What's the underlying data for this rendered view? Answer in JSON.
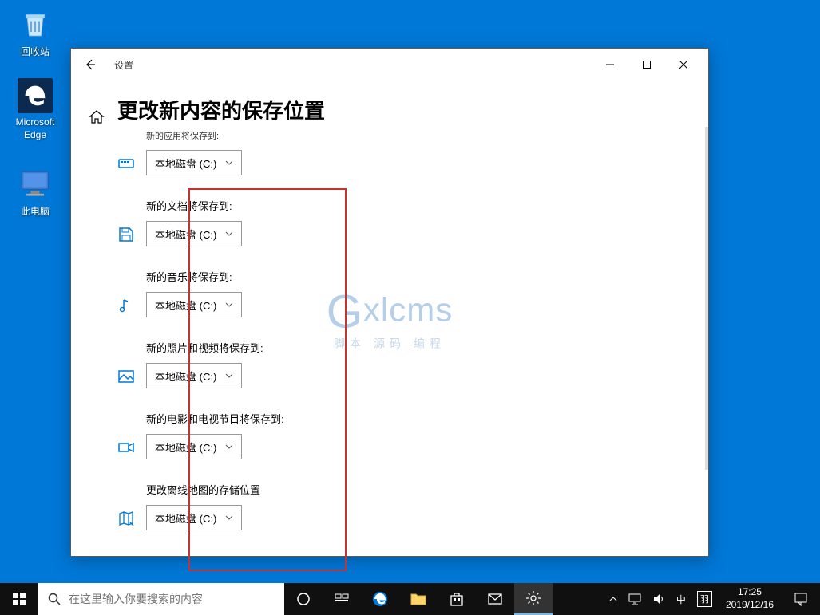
{
  "desktop": {
    "recycle_bin": "回收站",
    "edge": "Microsoft Edge",
    "this_pc": "此电脑"
  },
  "window": {
    "title": "设置",
    "page_title": "更改新内容的保存位置",
    "settings": [
      {
        "label": "新的应用将保存到:",
        "value": "本地磁盘 (C:)"
      },
      {
        "label": "新的文档将保存到:",
        "value": "本地磁盘 (C:)"
      },
      {
        "label": "新的音乐将保存到:",
        "value": "本地磁盘 (C:)"
      },
      {
        "label": "新的照片和视频将保存到:",
        "value": "本地磁盘 (C:)"
      },
      {
        "label": "新的电影和电视节目将保存到:",
        "value": "本地磁盘 (C:)"
      },
      {
        "label": "更改离线地图的存储位置",
        "value": "本地磁盘 (C:)"
      }
    ]
  },
  "watermark": {
    "main": "xlcms",
    "sub": "脚本 源码 编程"
  },
  "taskbar": {
    "search_placeholder": "在这里输入你要搜索的内容",
    "ime1": "中",
    "ime2": "羽",
    "time": "17:25",
    "date": "2019/12/16"
  }
}
